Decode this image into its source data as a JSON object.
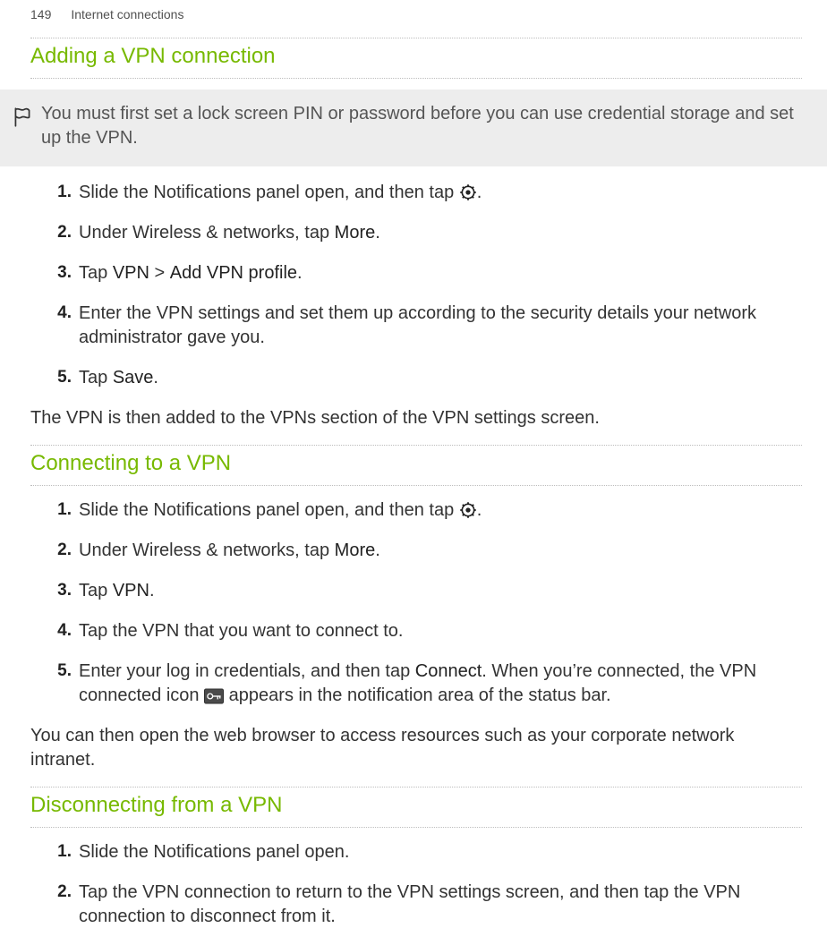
{
  "header": {
    "page_number": "149",
    "chapter": "Internet connections"
  },
  "section1": {
    "title": "Adding a VPN connection",
    "notice": "You must first set a lock screen PIN or password before you can use credential storage and set up the VPN.",
    "steps": {
      "n1": "1.",
      "s1a": "Slide the Notifications panel open, and then tap ",
      "s1b": ".",
      "n2": "2.",
      "s2a": "Under Wireless & networks, tap ",
      "s2b": "More",
      "s2c": ".",
      "n3": "3.",
      "s3a": "Tap ",
      "s3b": "VPN",
      "s3c": " > ",
      "s3d": "Add VPN profile",
      "s3e": ".",
      "n4": "4.",
      "s4": "Enter the VPN settings and set them up according to the security details your network administrator gave you.",
      "n5": "5.",
      "s5a": "Tap ",
      "s5b": "Save",
      "s5c": "."
    },
    "after": "The VPN is then added to the VPNs section of the VPN settings screen."
  },
  "section2": {
    "title": "Connecting to a VPN",
    "steps": {
      "n1": "1.",
      "s1a": "Slide the Notifications panel open, and then tap ",
      "s1b": ".",
      "n2": "2.",
      "s2a": "Under Wireless & networks, tap ",
      "s2b": "More",
      "s2c": ".",
      "n3": "3.",
      "s3a": "Tap ",
      "s3b": "VPN",
      "s3c": ".",
      "n4": "4.",
      "s4": "Tap the VPN that you want to connect to.",
      "n5": "5.",
      "s5a": "Enter your log in credentials, and then tap ",
      "s5b": "Connect",
      "s5c": ". When you’re connected, the VPN connected icon ",
      "s5d": " appears in the notification area of the status bar."
    },
    "after": "You can then open the web browser to access resources such as your corporate network intranet."
  },
  "section3": {
    "title": "Disconnecting from a VPN",
    "steps": {
      "n1": "1.",
      "s1": "Slide the Notifications panel open.",
      "n2": "2.",
      "s2": "Tap the VPN connection to return to the VPN settings screen, and then tap the VPN connection to disconnect from it."
    }
  }
}
